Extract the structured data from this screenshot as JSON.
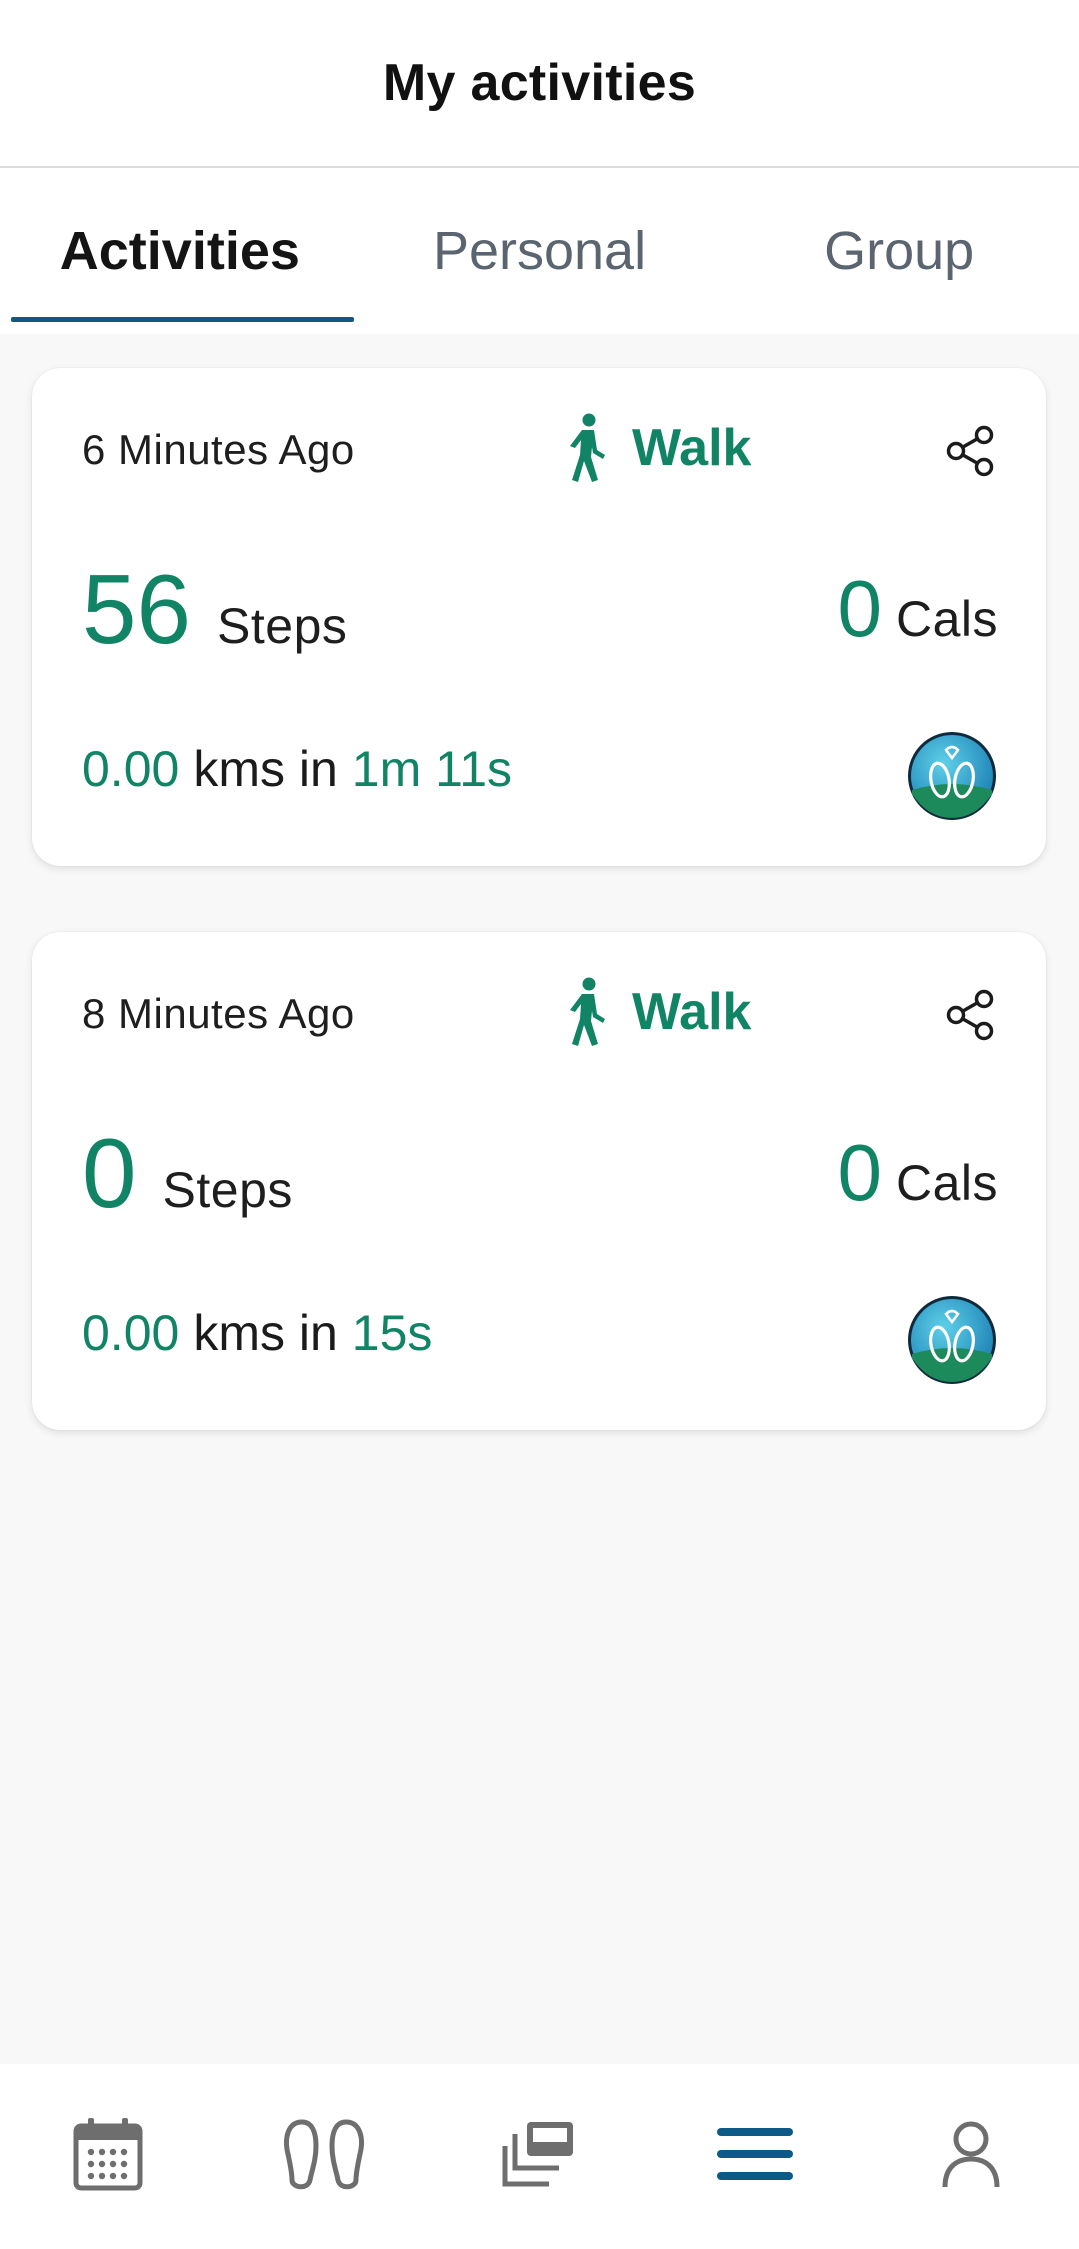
{
  "header": {
    "title": "My activities"
  },
  "tabs": [
    {
      "label": "Activities",
      "active": true
    },
    {
      "label": "Personal",
      "active": false
    },
    {
      "label": "Group",
      "active": false
    }
  ],
  "activities": [
    {
      "time_ago": "6 Minutes Ago",
      "type": "Walk",
      "steps": "56",
      "steps_label": "Steps",
      "cals": "0",
      "cals_label": "Cals",
      "distance": "0.00",
      "distance_mid": "kms in",
      "duration": "1m 11s"
    },
    {
      "time_ago": "8 Minutes Ago",
      "type": "Walk",
      "steps": "0",
      "steps_label": "Steps",
      "cals": "0",
      "cals_label": "Cals",
      "distance": "0.00",
      "distance_mid": "kms in",
      "duration": "15s"
    }
  ],
  "bottom_nav": [
    {
      "icon": "calendar-icon",
      "active": false
    },
    {
      "icon": "footprints-icon",
      "active": false
    },
    {
      "icon": "gallery-icon",
      "active": false
    },
    {
      "icon": "menu-icon",
      "active": true
    },
    {
      "icon": "profile-icon",
      "active": false
    }
  ],
  "colors": {
    "accent": "#118465",
    "tab_underline": "#0e5a86",
    "nav_active": "#0e5a86",
    "nav_inactive": "#6e6e6e"
  }
}
